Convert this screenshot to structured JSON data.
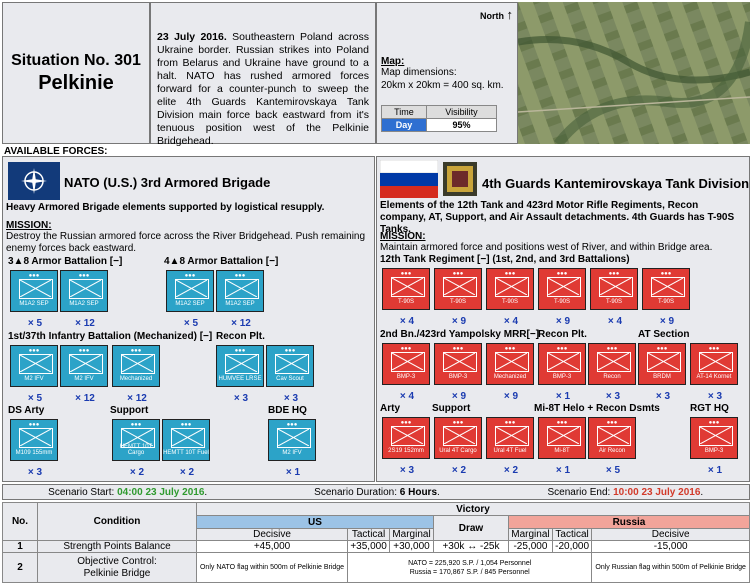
{
  "header": {
    "situation_label": "Situation No. 301",
    "location": "Pelkinie",
    "date_bold": "23 July 2016.",
    "description": " Southeastern Poland across Ukraine border. Russian strikes into Poland from Belarus and Ukraine have ground to a halt. NATO has rushed armored forces forward for a counter-punch to sweep the elite 4th Guards Kantemirovskaya Tank Division main force back eastward from it's tenuous position west of the Pelkinie Bridgehead.",
    "map_heading": "Map:",
    "map_dim_label": "Map dimensions:",
    "map_dim_value": "20km x 20km = 400 sq. km.",
    "north": "North",
    "time_header": "Time",
    "visibility_header": "Visibility",
    "time_value": "Day",
    "visibility_value": "95%"
  },
  "available_forces_label": "AVAILABLE FORCES:",
  "nato": {
    "title": "NATO (U.S.) 3rd Armored Brigade",
    "subtitle": "Heavy Armored Brigade elements supported by logistical resupply.",
    "mission_label": "MISSION:",
    "mission": "Destroy the Russian armored force across the River Bridgehead. Push remaining enemy forces back eastward.",
    "groups": [
      {
        "label": "3▲8 Armor Battalion [−]"
      },
      {
        "label": "4▲8 Armor Battalion [−]"
      },
      {
        "label": "1st/37th Infantry Battalion (Mechanized) [−]"
      },
      {
        "label": "Recon Plt."
      },
      {
        "label": "DS Arty"
      },
      {
        "label": "Support"
      },
      {
        "label": "BDE HQ"
      }
    ],
    "units": [
      {
        "label": "M1A2 SEP",
        "qty": "× 5"
      },
      {
        "label": "M1A2 SEP",
        "qty": "× 12"
      },
      {
        "label": "M1A2 SEP",
        "qty": "× 5"
      },
      {
        "label": "M1A2 SEP",
        "qty": "× 12"
      },
      {
        "label": "M2 IFV",
        "qty": "× 5"
      },
      {
        "label": "M2 IFV",
        "qty": "× 12"
      },
      {
        "label": "Mechanized",
        "qty": "× 12"
      },
      {
        "label": "HUMVEE LRSE",
        "qty": "× 3"
      },
      {
        "label": "Cav Scout",
        "qty": "× 3"
      },
      {
        "label": "M109 155mm",
        "qty": "× 3"
      },
      {
        "label": "HEMTT 10T Cargo",
        "qty": "× 2"
      },
      {
        "label": "HEMTT 10T Fuel",
        "qty": "× 2"
      },
      {
        "label": "M2 IFV",
        "qty": "× 1"
      }
    ]
  },
  "russia": {
    "title": "4th Guards Kantemirovskaya Tank Division",
    "subtitle": "Elements of the 12th Tank and 423rd Motor Rifle Regiments, Recon company, AT, Support, and Air Assault detachments. 4th Guards has T-90S Tanks.",
    "mission_label": "MISSION:",
    "mission": "Maintain armored force and positions west of River, and within Bridge area.",
    "groups": [
      {
        "label": "12th Tank Regiment [−] (1st, 2nd, and 3rd Battalions)"
      },
      {
        "label": "2nd Bn./423rd Yampolsky MRR[−]"
      },
      {
        "label": "Recon Plt."
      },
      {
        "label": "AT Section"
      },
      {
        "label": "Arty"
      },
      {
        "label": "Support"
      },
      {
        "label": "Mi-8T Helo + Recon Dsmts"
      },
      {
        "label": "RGT HQ"
      }
    ],
    "units": [
      {
        "label": "T-90S",
        "qty": "× 4"
      },
      {
        "label": "T-90S",
        "qty": "× 9"
      },
      {
        "label": "T-90S",
        "qty": "× 4"
      },
      {
        "label": "T-90S",
        "qty": "× 9"
      },
      {
        "label": "T-90S",
        "qty": "× 4"
      },
      {
        "label": "T-90S",
        "qty": "× 9"
      },
      {
        "label": "BMP-3",
        "qty": "× 4"
      },
      {
        "label": "BMP-3",
        "qty": "× 9"
      },
      {
        "label": "Mechanized",
        "qty": "× 9"
      },
      {
        "label": "BMP-3",
        "qty": "× 1"
      },
      {
        "label": "Recon",
        "qty": "× 3"
      },
      {
        "label": "BRDM",
        "qty": "× 3"
      },
      {
        "label": "AT-14 Kornet",
        "qty": "× 3"
      },
      {
        "label": "2S19 152mm",
        "qty": "× 3"
      },
      {
        "label": "Ural 4T Cargo",
        "qty": "× 2"
      },
      {
        "label": "Ural 4T Fuel",
        "qty": "× 2"
      },
      {
        "label": "Mi-8T",
        "qty": "× 1"
      },
      {
        "label": "Air Recon",
        "qty": "× 5"
      },
      {
        "label": "BMP-3",
        "qty": "× 1"
      }
    ]
  },
  "scenario": {
    "start_label": "Scenario Start:",
    "start_value": "04:00 23 July 2016",
    "duration_label": "Scenario Duration:",
    "duration_value": "6 Hours",
    "end_label": "Scenario End:",
    "end_value": "10:00 23 July 2016"
  },
  "victory": {
    "no_label": "No.",
    "condition_label": "Condition",
    "victory_label": "Victory",
    "us_label": "US",
    "russia_label": "Russia",
    "draw_label": "Draw",
    "levels": [
      "Decisive",
      "Tactical",
      "Marginal",
      "Marginal",
      "Tactical",
      "Decisive"
    ],
    "row1": {
      "no": "1",
      "condition": "Strength Points Balance",
      "values": [
        "+45,000",
        "+35,000",
        "+30,000",
        "+30k ↔ -25k",
        "-25,000",
        "-20,000",
        "-15,000"
      ]
    },
    "row2": {
      "no": "2",
      "condition_a": "Objective Control:",
      "condition_b": "Pelkinie Bridge",
      "us_decisive": "Only NATO flag within 500m of Pelkinie Bridge",
      "mid_a": "NATO = 225,920 S.P. / 1,054 Personnel",
      "mid_b": "Russia = 170,867 S.P. / 845 Personnel",
      "ru_decisive": "Only Russian flag within 500m of Pelkinie Bridge"
    }
  },
  "colors": {
    "us_blue": "#9cc3e6",
    "russia_red": "#f2a49a",
    "day_blue": "#2e6fd1",
    "start_green": "#2f9a2f",
    "end_red": "#d23a2a",
    "nato_counter": "#2ca3c8",
    "russia_counter": "#e03a34"
  }
}
